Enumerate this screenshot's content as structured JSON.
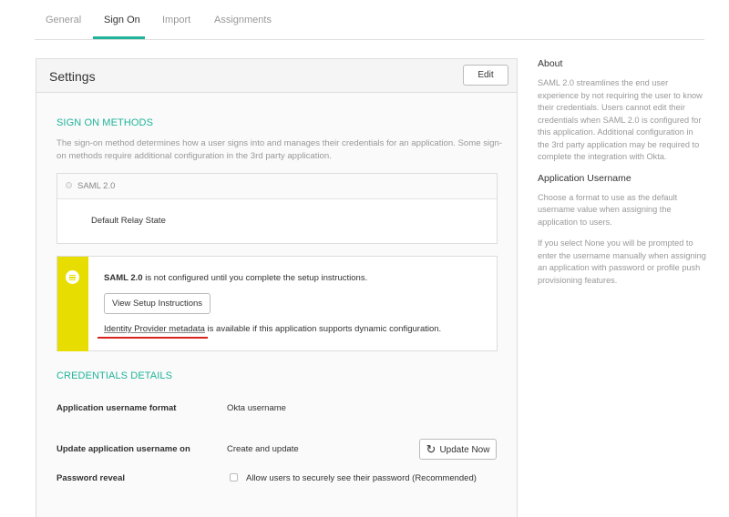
{
  "tabs": [
    {
      "label": "General"
    },
    {
      "label": "Sign On"
    },
    {
      "label": "Import"
    },
    {
      "label": "Assignments"
    }
  ],
  "settings": {
    "title": "Settings",
    "edit_label": "Edit"
  },
  "sign_on": {
    "section_title": "SIGN ON METHODS",
    "description": "The sign-on method determines how a user signs into and manages their credentials for an application. Some sign-on methods require additional configuration in the 3rd party application.",
    "method_label": "SAML 2.0",
    "relay_label": "Default Relay State"
  },
  "warning": {
    "bold": "SAML 2.0",
    "text": " is not configured until you complete the setup instructions.",
    "setup_button": "View Setup Instructions",
    "idp_link": "Identity Provider metadata",
    "idp_text": " is available if this application supports dynamic configuration.",
    "bar_color": "#e8dd00"
  },
  "credentials": {
    "section_title": "CREDENTIALS DETAILS",
    "username_format_label": "Application username format",
    "username_format_value": "Okta username",
    "update_label": "Update application username on",
    "update_value": "Create and update",
    "update_button": "Update Now",
    "password_reveal_label": "Password reveal",
    "password_reveal_option": "Allow users to securely see their password (Recommended)"
  },
  "about": {
    "title": "About",
    "text": "SAML 2.0 streamlines the end user experience by not requiring the user to know their credentials. Users cannot edit their credentials when SAML 2.0 is configured for this application. Additional configuration in the 3rd party application may be required to complete the integration with Okta.",
    "username_title": "Application Username",
    "username_text1": "Choose a format to use as the default username value when assigning the application to users.",
    "username_text2": "If you select None you will be prompted to enter the username manually when assigning an application with password or profile push provisioning features."
  },
  "colors": {
    "accent": "#1fb39a",
    "warning": "#e8dd00",
    "highlight_underline": "#d9231b"
  }
}
